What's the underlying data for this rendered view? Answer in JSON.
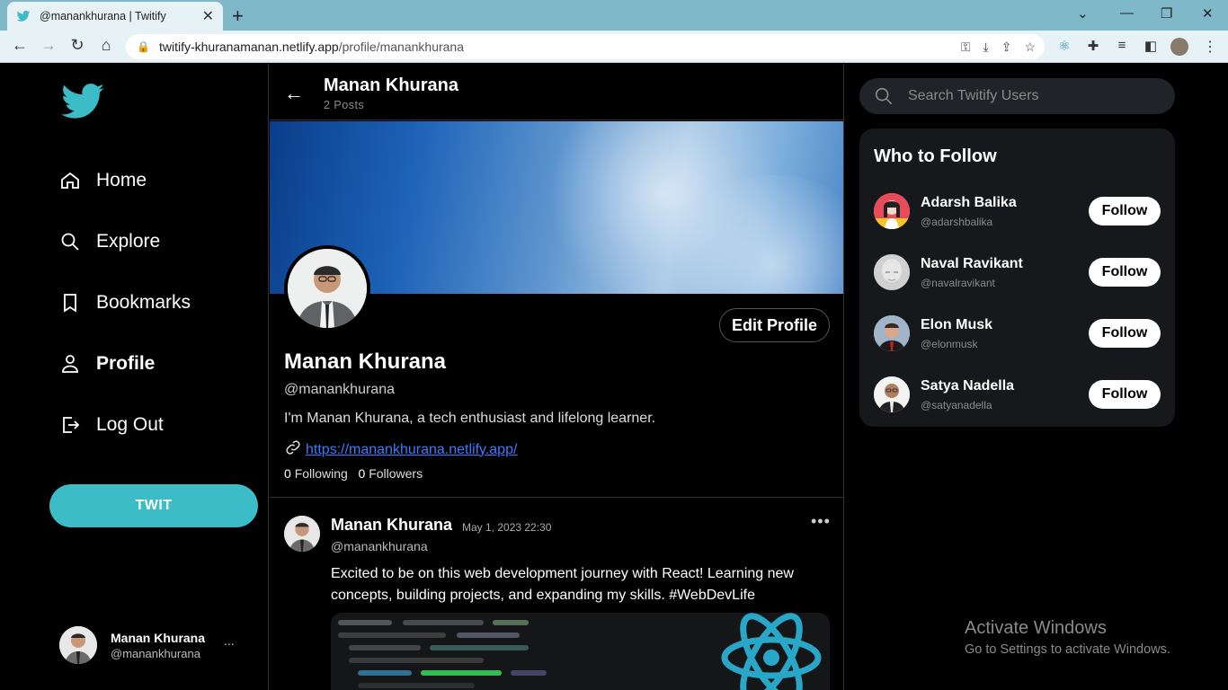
{
  "browser": {
    "tab_title": "@manankhurana | Twitify",
    "url_host": "twitify-khuranamanan.netlify.app",
    "url_path": "/profile/manankhurana"
  },
  "nav": {
    "items": [
      {
        "label": "Home",
        "icon": "home-icon"
      },
      {
        "label": "Explore",
        "icon": "search-icon"
      },
      {
        "label": "Bookmarks",
        "icon": "bookmark-icon"
      },
      {
        "label": "Profile",
        "icon": "user-icon",
        "active": true
      },
      {
        "label": "Log Out",
        "icon": "logout-icon"
      }
    ],
    "twit_button": "TWIT",
    "user": {
      "name": "Manan Khurana",
      "handle": "@manankhurana",
      "more": "..."
    }
  },
  "header": {
    "title": "Manan Khurana",
    "subtitle": "2 Posts"
  },
  "profile": {
    "name": "Manan Khurana",
    "handle": "@manankhurana",
    "bio": "I'm Manan Khurana, a tech enthusiast and lifelong learner.",
    "link": "https://manankhurana.netlify.app/",
    "following_count": "0",
    "following_label": "Following",
    "followers_count": "0",
    "followers_label": "Followers",
    "edit_button": "Edit Profile"
  },
  "post": {
    "author": "Manan Khurana",
    "timestamp": "May 1, 2023 22:30",
    "handle": "@manankhurana",
    "text": "Excited to be on this web development journey with React! Learning new concepts, building projects, and expanding my skills. #WebDevLife"
  },
  "search": {
    "placeholder": "Search Twitify Users"
  },
  "who_to_follow": {
    "title": "Who to Follow",
    "users": [
      {
        "name": "Adarsh Balika",
        "handle": "@adarshbalika",
        "button": "Follow"
      },
      {
        "name": "Naval Ravikant",
        "handle": "@navalravikant",
        "button": "Follow"
      },
      {
        "name": "Elon Musk",
        "handle": "@elonmusk",
        "button": "Follow"
      },
      {
        "name": "Satya Nadella",
        "handle": "@satyanadella",
        "button": "Follow"
      }
    ]
  },
  "watermark": {
    "line1": "Activate Windows",
    "line2": "Go to Settings to activate Windows."
  },
  "colors": {
    "accent": "#3cbcc6",
    "link": "#3a7bff",
    "background": "#000000"
  }
}
